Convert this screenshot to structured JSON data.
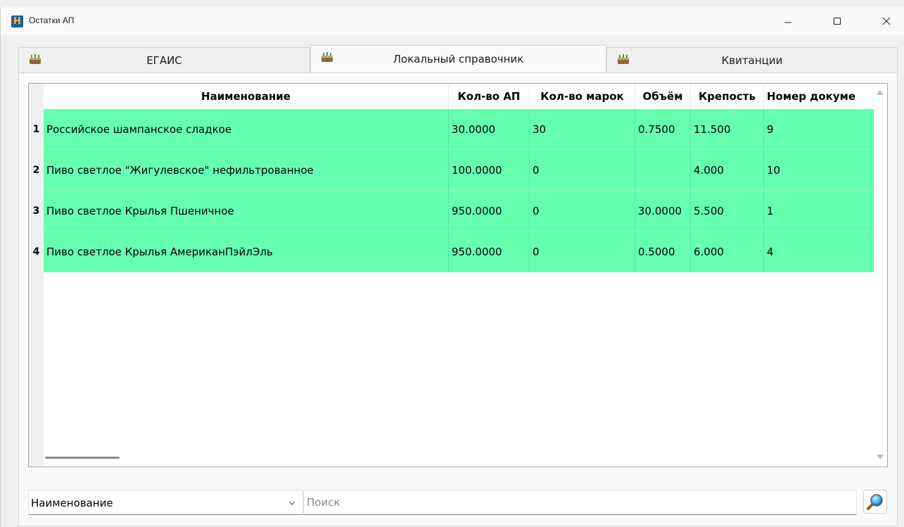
{
  "window": {
    "title": "Остатки АП",
    "app_icon_letter": "H"
  },
  "tabs": [
    {
      "label": "ЕГАИС",
      "active": false
    },
    {
      "label": "Локальный справочник",
      "active": true
    },
    {
      "label": "Квитанции",
      "active": false
    }
  ],
  "table": {
    "columns": [
      "Наименование",
      "Кол-во АП",
      "Кол-во марок",
      "Объём",
      "Крепость",
      "Номер докуме"
    ],
    "rows": [
      {
        "num": "1",
        "cells": [
          "Российское шампанское сладкое",
          "30.0000",
          "30",
          "0.7500",
          "11.500",
          "9"
        ]
      },
      {
        "num": "2",
        "cells": [
          "Пиво светлое \"Жигулевское\" нефильтрованное",
          "100.0000",
          "0",
          "",
          "4.000",
          "10"
        ]
      },
      {
        "num": "3",
        "cells": [
          "Пиво светлое Крылья Пшеничное",
          "950.0000",
          "0",
          "30.0000",
          "5.500",
          "1"
        ]
      },
      {
        "num": "4",
        "cells": [
          "Пиво светлое Крылья АмериканПэйлЭль",
          "950.0000",
          "0",
          "0.5000",
          "6.000",
          "4"
        ]
      }
    ],
    "row_color": "#66ffb0"
  },
  "search": {
    "field_select": "Наименование",
    "placeholder": "Поиск",
    "value": ""
  },
  "icons": {
    "app": "app-logo-icon",
    "tab": "cake-icon",
    "search": "magnifier-icon"
  }
}
